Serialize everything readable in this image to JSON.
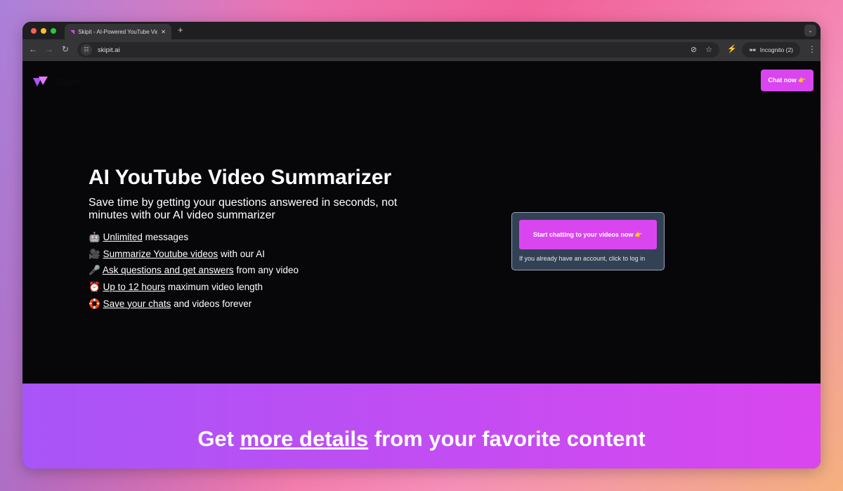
{
  "browser": {
    "tab_title": "Skipit - AI-Powered YouTube Video Summarizer",
    "url": "skipit.ai",
    "incognito_label": "Incognito (2)"
  },
  "header": {
    "brand": "Skipit",
    "chat_button": "Chat now 👉"
  },
  "hero": {
    "title": "AI YouTube Video Summarizer",
    "subtitle": "Save time by getting your questions answered in seconds, not minutes with our AI video summarizer",
    "features": [
      {
        "emoji": "🤖",
        "link": "Unlimited",
        "rest": " messages"
      },
      {
        "emoji": "🎥",
        "link": "Summarize Youtube videos",
        "rest": " with our AI"
      },
      {
        "emoji": "🎤",
        "link": "Ask questions and get answers",
        "rest": " from any video"
      },
      {
        "emoji": "⏰",
        "link": "Up to 12 hours",
        "rest": " maximum video length"
      },
      {
        "emoji": "🛟",
        "link": "Save your chats",
        "rest": " and videos forever"
      }
    ]
  },
  "cta": {
    "button": "Start chatting to your videos now 👉",
    "login_text": "If you already have an account, click to log in"
  },
  "band": {
    "pre": "Get ",
    "link": "more details",
    "post": " from your favorite content"
  },
  "colors": {
    "accent": "#d946ef",
    "card": "#334155",
    "band_start": "#a855f7"
  }
}
